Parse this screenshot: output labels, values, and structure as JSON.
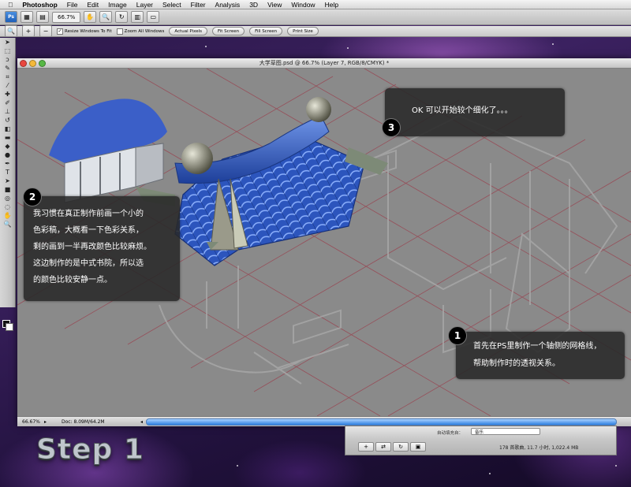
{
  "menubar": {
    "app_name": "Photoshop",
    "items": [
      "File",
      "Edit",
      "Image",
      "Layer",
      "Select",
      "Filter",
      "Analysis",
      "3D",
      "View",
      "Window",
      "Help"
    ]
  },
  "appbar": {
    "ps_logo": "Ps",
    "zoom_level": "66.7%"
  },
  "options": {
    "resize_windows": "Resize Windows To Fit",
    "zoom_all_windows": "Zoom All Windows",
    "actual_pixels": "Actual Pixels",
    "fit_screen": "Fit Screen",
    "fill_screen": "Fill Screen",
    "print_size": "Print Size"
  },
  "document": {
    "title": "大学草图.psd @ 66.7% (Layer 7, RGB/8/CMYK) *",
    "status_zoom": "66.67%",
    "status_doc": "Doc: 8.09M/64.2M"
  },
  "itunes": {
    "autofill_label": "自动填充自：",
    "autofill_value": "音乐",
    "status": "178 首歌曲, 11.7 小时, 1,022.4 MB"
  },
  "callouts": [
    {
      "number": "1",
      "lines": [
        "首先在PS里制作一个轴侧的网格线，",
        "帮助制作时的透视关系。"
      ]
    },
    {
      "number": "2",
      "lines": [
        "我习惯在真正制作前画一个小的",
        "色彩稿，大概看一下色彩关系，",
        "剩的画到一半再改颜色比较麻烦。",
        "这边制作的是中式书院，所以选",
        "的颜色比较安静一点。"
      ]
    },
    {
      "number": "3",
      "lines": [
        "OK 可以开始较个细化了。。。"
      ]
    }
  ],
  "step_label": "Step 1",
  "colors": {
    "roof_blue": "#2f5fc4",
    "callout_bg": "#2a2a2a",
    "grid_line": "#9a3c4a"
  }
}
